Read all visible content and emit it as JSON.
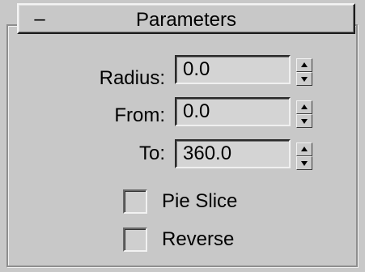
{
  "rollout": {
    "toggle": "–",
    "title": "Parameters"
  },
  "params": [
    {
      "label": "Radius:",
      "value": "0.0"
    },
    {
      "label": "From:",
      "value": "0.0"
    },
    {
      "label": "To:",
      "value": "360.0"
    }
  ],
  "options": [
    {
      "label": "Pie Slice",
      "checked": false
    },
    {
      "label": "Reverse",
      "checked": false
    }
  ],
  "icons": {
    "spinner": "up-down-arrows",
    "toggle": "minus-sign"
  }
}
